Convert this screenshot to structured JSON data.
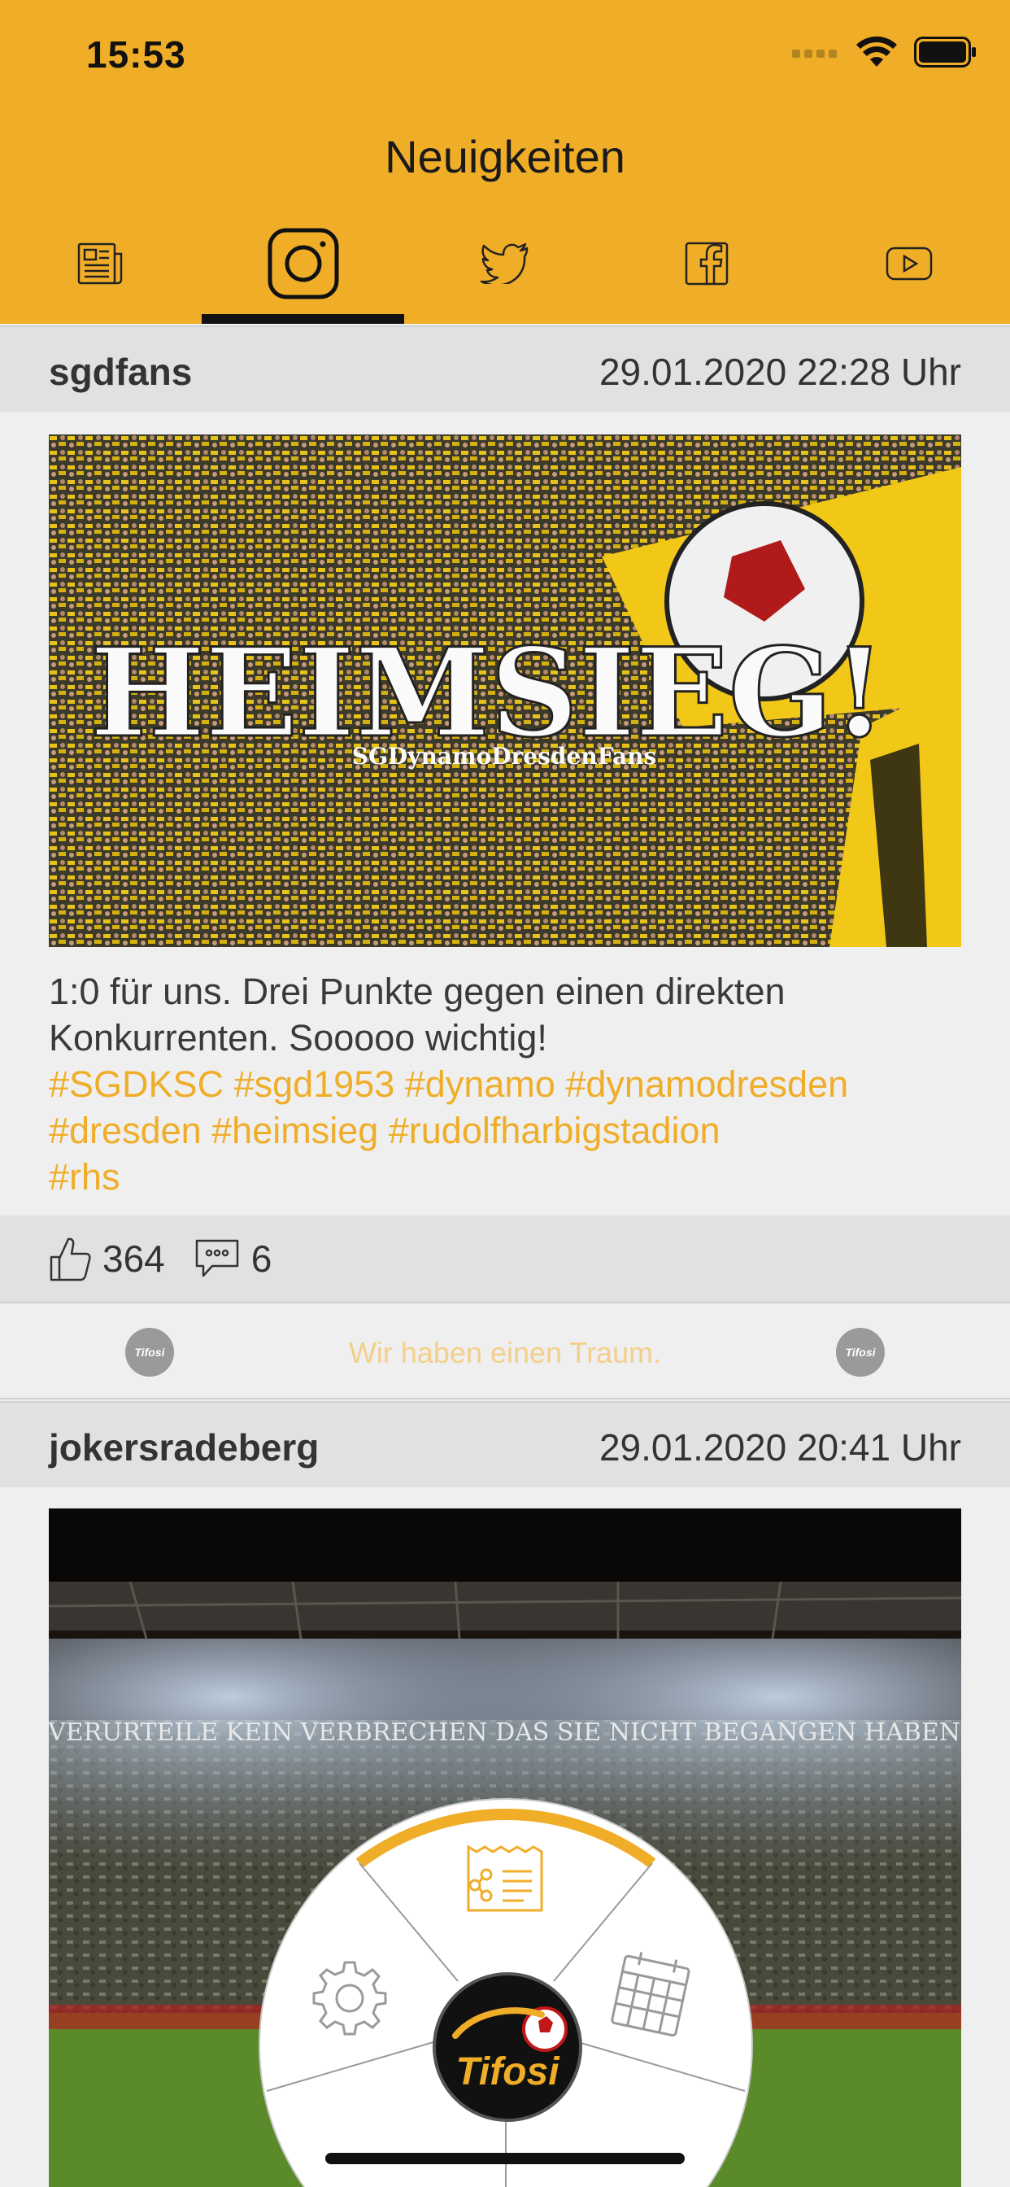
{
  "status_bar": {
    "time": "15:53"
  },
  "header": {
    "title": "Neuigkeiten",
    "tabs": [
      {
        "icon": "newspaper-icon",
        "active": false
      },
      {
        "icon": "instagram-icon",
        "active": true
      },
      {
        "icon": "twitter-icon",
        "active": false
      },
      {
        "icon": "facebook-icon",
        "active": false
      },
      {
        "icon": "youtube-icon",
        "active": false
      }
    ]
  },
  "posts": [
    {
      "user": "sgdfans",
      "date": "29.01.2020 22:28 Uhr",
      "image_text": "HEIMSIEG!",
      "image_subtext": "SGDynamoDresdenFans",
      "text": "1:0 für uns. Drei Punkte gegen einen direkten Konkurrenten. Sooooo wichtig!",
      "tags_line1": "#SGDKSC #sgd1953 #dynamo #dynamodresden",
      "tags_line2": "#dresden #heimsieg #rudolfharbigstadion",
      "tags_line3": "#rhs",
      "likes": "364",
      "comments": "6"
    },
    {
      "user": "jokersradeberg",
      "date": "29.01.2020 20:41 Uhr",
      "banner_text": "VERURTEILE KEIN VERBRECHEN DAS SIE NICHT BEGANGEN HABEN"
    }
  ],
  "banner": {
    "text": "Wir haben einen Traum.",
    "logo_text": "Tifosi"
  },
  "radial_menu": {
    "center_logo": "Tifosi"
  },
  "colors": {
    "accent": "#f0ad28",
    "header_bg": "#f0ad28",
    "bar_bg": "#e1e1e1"
  }
}
